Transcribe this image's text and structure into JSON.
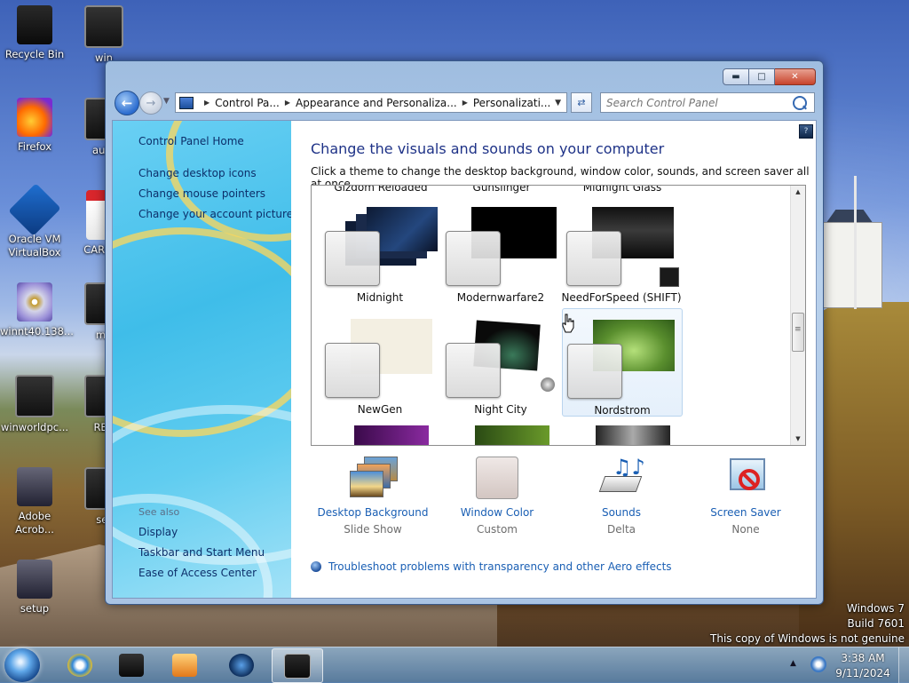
{
  "desktop": {
    "icons": [
      {
        "label": "Recycle Bin"
      },
      {
        "label": "win"
      },
      {
        "label": "Firefox"
      },
      {
        "label": "auto"
      },
      {
        "label": "Oracle VM VirtualBox"
      },
      {
        "label": "CARS_N"
      },
      {
        "label": "winnt40.138..."
      },
      {
        "label": "me"
      },
      {
        "label": "winworldpc..."
      },
      {
        "label": "REA"
      },
      {
        "label": "Adobe Acrob..."
      },
      {
        "label": "set"
      },
      {
        "label": "setup"
      }
    ]
  },
  "window": {
    "buttons": {
      "minimize_icon": "minimize-icon",
      "maximize_icon": "maximize-icon",
      "close_icon": "close-icon"
    },
    "address": {
      "crumbs": [
        "Control Pa...",
        "Appearance and Personaliza...",
        "Personalizati..."
      ]
    },
    "search": {
      "placeholder": "Search Control Panel"
    },
    "sidebar": {
      "home": "Control Panel Home",
      "links": [
        "Change desktop icons",
        "Change mouse pointers",
        "Change your account picture"
      ],
      "see_also_label": "See also",
      "see_also": [
        "Display",
        "Taskbar and Start Menu",
        "Ease of Access Center"
      ]
    },
    "main": {
      "title": "Change the visuals and sounds on your computer",
      "subtitle": "Click a theme to change the desktop background, window color, sounds, and screen saver all at once.",
      "top_cut_names": [
        "Gizdom Reloaded",
        "Gunslinger",
        "Midnight Glass"
      ],
      "themes": [
        {
          "name": "Midnight",
          "accent": "#1a2a4a"
        },
        {
          "name": "Modernwarfare2",
          "accent": "#000000"
        },
        {
          "name": "NeedForSpeed (SHIFT)",
          "accent": "#2b2b2b"
        },
        {
          "name": "NewGen",
          "accent": "#f3efe2"
        },
        {
          "name": "Night City",
          "accent": "#0a0a0a"
        },
        {
          "name": "Nordstrom",
          "accent": "#6a9a3a",
          "selected": true
        }
      ],
      "settings": [
        {
          "label": "Desktop Background",
          "value": "Slide Show",
          "icon": "desktop-background-icon"
        },
        {
          "label": "Window Color",
          "value": "Custom",
          "icon": "window-color-icon"
        },
        {
          "label": "Sounds",
          "value": "Delta",
          "icon": "sounds-icon"
        },
        {
          "label": "Screen Saver",
          "value": "None",
          "icon": "screen-saver-icon"
        }
      ],
      "troubleshoot": "Troubleshoot problems with transparency and other Aero effects"
    }
  },
  "watermark": {
    "line1": "Windows 7",
    "line2": "Build 7601",
    "line3": "This copy of Windows is not genuine"
  },
  "taskbar": {
    "time": "3:38 AM",
    "date": "9/11/2024"
  }
}
